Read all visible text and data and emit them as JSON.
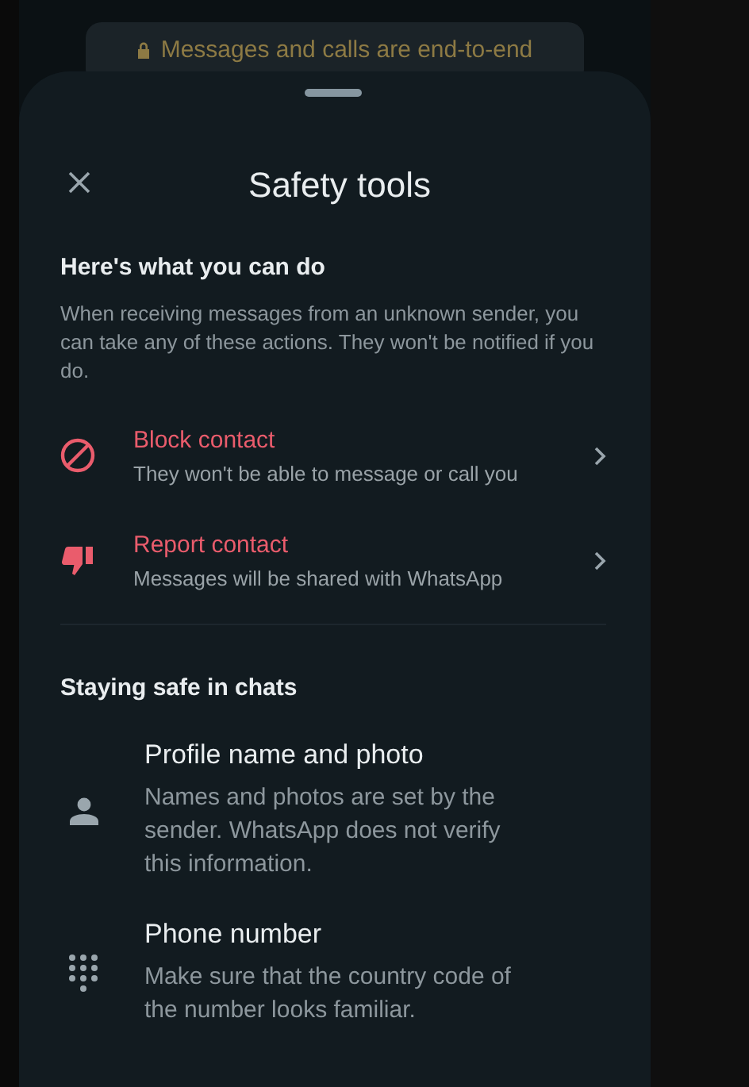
{
  "banner": {
    "text": "Messages and calls are end-to-end"
  },
  "sheet": {
    "title": "Safety tools",
    "section_1": {
      "heading": "Here's what you can do",
      "description": "When receiving messages from an unknown sender, you can take any of these actions. They won't be notified if you do."
    },
    "actions": [
      {
        "kind": "block",
        "title": "Block contact",
        "subtitle": "They won't be able to message or call you"
      },
      {
        "kind": "report",
        "title": "Report contact",
        "subtitle": "Messages will be shared with WhatsApp"
      }
    ],
    "section_2": {
      "heading": "Staying safe in chats"
    },
    "tips": [
      {
        "kind": "profile",
        "title": "Profile name and photo",
        "description": "Names and photos are set by the sender. WhatsApp does not verify this information."
      },
      {
        "kind": "phone",
        "title": "Phone number",
        "description": "Make sure that the country code of the number looks familiar."
      }
    ]
  }
}
